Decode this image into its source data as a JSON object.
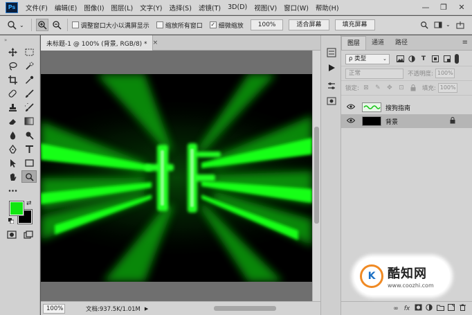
{
  "app": {
    "logo_text": "Ps",
    "menus": [
      "文件(F)",
      "编辑(E)",
      "图像(I)",
      "图层(L)",
      "文字(Y)",
      "选择(S)",
      "滤镜(T)",
      "3D(D)",
      "视图(V)",
      "窗口(W)",
      "帮助(H)"
    ],
    "window_controls": {
      "minimize": "—",
      "restore": "❐",
      "close": "✕"
    }
  },
  "options": {
    "resize_windows_label": "调整窗口大小以满屏显示",
    "zoom_all_label": "缩放所有窗口",
    "scrubby_zoom_label": "细微缩放",
    "zoom_value": "100%",
    "fit_screen_label": "适合屏幕",
    "fill_screen_label": "填充屏幕"
  },
  "document": {
    "tab_title": "未标题-1 @ 100% (背景, RGB/8) *",
    "tab_close": "×",
    "zoom": "100%",
    "info": "文档:937.5K/1.01M"
  },
  "colors": {
    "foreground": "#11e611",
    "background": "#000000",
    "glow": "#16ff16"
  },
  "layers_panel": {
    "tabs": [
      "图层",
      "通道",
      "路径"
    ],
    "filter_label": "ρ 类型",
    "blend_mode": "正常",
    "opacity_label": "不透明度:",
    "opacity_value": "100%",
    "lock_label": "锁定:",
    "fill_label": "填充:",
    "fill_value": "100%",
    "layers": [
      {
        "name": "搜狗指南",
        "visible": true,
        "locked": false,
        "selected": false
      },
      {
        "name": "背景",
        "visible": true,
        "locked": true,
        "selected": true
      }
    ],
    "footer_icons": [
      "link-icon",
      "fx-icon",
      "mask-icon",
      "adjustment-icon",
      "group-icon",
      "new-layer-icon",
      "trash-icon"
    ]
  },
  "watermark": {
    "logo_letter": "K",
    "title": "酷知网",
    "url": "www.coozhi.com"
  }
}
